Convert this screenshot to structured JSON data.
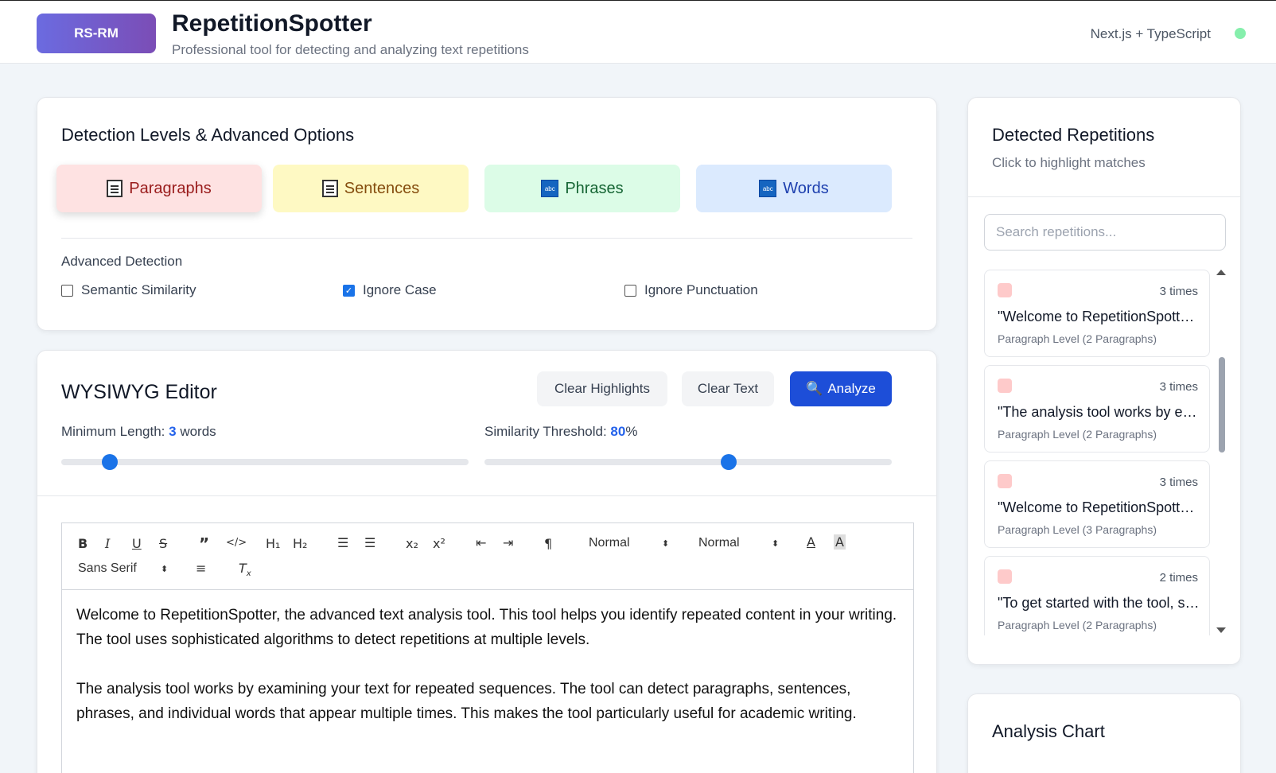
{
  "header": {
    "logo": "RS-RM",
    "title": "RepetitionSpotter",
    "subtitle": "Professional tool for detecting and analyzing text repetitions",
    "tech": "Next.js + TypeScript",
    "status_color": "#86efac"
  },
  "detection": {
    "title": "Detection Levels & Advanced Options",
    "levels": [
      {
        "label": "Paragraphs",
        "icon": "page-icon",
        "bg": "#fee2e2",
        "fg": "#991b1b",
        "active": true
      },
      {
        "label": "Sentences",
        "icon": "memo-icon",
        "bg": "#fef9c3",
        "fg": "#854d0e",
        "active": false
      },
      {
        "label": "Phrases",
        "icon": "abc-icon",
        "bg": "#dcfce7",
        "fg": "#166534",
        "active": false
      },
      {
        "label": "Words",
        "icon": "abc-icon",
        "bg": "#dbeafe",
        "fg": "#1e40af",
        "active": false
      }
    ],
    "advanced_label": "Advanced Detection",
    "options": [
      {
        "label": "Semantic Similarity",
        "checked": false
      },
      {
        "label": "Ignore Case",
        "checked": true
      },
      {
        "label": "Ignore Punctuation",
        "checked": false
      }
    ]
  },
  "editor": {
    "title": "WYSIWYG Editor",
    "buttons": {
      "clear_highlights": "Clear Highlights",
      "clear_text": "Clear Text",
      "analyze": "Analyze"
    },
    "min_length": {
      "label": "Minimum Length:",
      "value": "3",
      "unit": "words",
      "fraction": 0.12
    },
    "similarity": {
      "label": "Similarity Threshold:",
      "value": "80",
      "unit": "%",
      "fraction": 0.6
    },
    "toolbar": {
      "header_select": "Normal",
      "size_select": "Normal",
      "font_select": "Sans Serif"
    },
    "paragraphs": [
      "Welcome to RepetitionSpotter, the advanced text analysis tool. This tool helps you identify repeated content in your writing. The tool uses sophisticated algorithms to detect repetitions at multiple levels.",
      "The analysis tool works by examining your text for repeated sequences. The tool can detect paragraphs, sentences, phrases, and individual words that appear multiple times. This makes the tool particularly useful for academic writing."
    ]
  },
  "repetitions": {
    "title": "Detected Repetitions",
    "subtitle": "Click to highlight matches",
    "search_placeholder": "Search repetitions...",
    "swatch_color": "#fecaca",
    "items": [
      {
        "count": "3 times",
        "text": "\"Welcome to RepetitionSpotter, the advanced text analysis tool.",
        "meta": "Paragraph Level (2 Paragraphs)"
      },
      {
        "count": "3 times",
        "text": "\"The analysis tool works by examining your text",
        "meta": "Paragraph Level (2 Paragraphs)"
      },
      {
        "count": "3 times",
        "text": "\"Welcome to RepetitionSpotter, the advanced text analysis tool.",
        "meta": "Paragraph Level (3 Paragraphs)"
      },
      {
        "count": "2 times",
        "text": "\"To get started with the tool, simply paste",
        "meta": "Paragraph Level (2 Paragraphs)"
      }
    ]
  },
  "chart": {
    "title": "Analysis Chart"
  }
}
